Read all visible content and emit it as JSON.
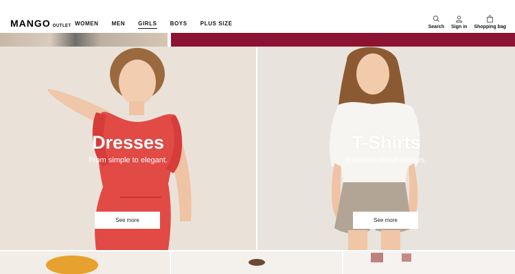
{
  "brand": {
    "name": "MANGO",
    "sub": "OUTLET"
  },
  "nav": [
    {
      "label": "WOMEN"
    },
    {
      "label": "MEN"
    },
    {
      "label": "GIRLS"
    },
    {
      "label": "BOYS"
    },
    {
      "label": "PLUS SIZE"
    }
  ],
  "actions": {
    "search": "Search",
    "sign_in": "Sign in",
    "bag": "Shopping bag"
  },
  "tiles": [
    {
      "title": "Dresses",
      "subtitle": "From simple to elegant.",
      "button": "See more"
    },
    {
      "title": "T-Shirts",
      "subtitle": "Essential closet staples.",
      "button": "See more"
    }
  ],
  "colors": {
    "accent_strip": "#8c1331"
  }
}
